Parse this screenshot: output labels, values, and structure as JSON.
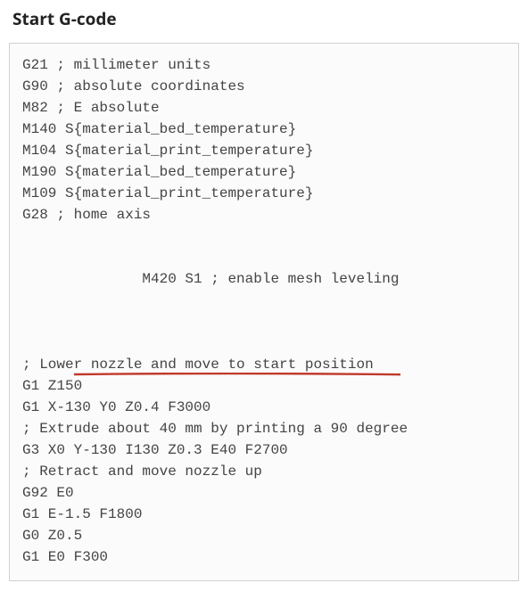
{
  "heading": "Start G-code",
  "code": {
    "lines": [
      "G21 ; millimeter units",
      "G90 ; absolute coordinates",
      "M82 ; E absolute",
      "M140 S{material_bed_temperature}",
      "M104 S{material_print_temperature}",
      "M190 S{material_bed_temperature}",
      "M109 S{material_print_temperature}",
      "G28 ; home axis",
      "M420 S1 ; enable mesh leveling",
      "; Lower nozzle and move to start position",
      "G1 Z150",
      "G1 X-130 Y0 Z0.4 F3000",
      "; Extrude about 40 mm by printing a 90 degree",
      "G3 X0 Y-130 I130 Z0.3 E40 F2700",
      "; Retract and move nozzle up",
      "G92 E0",
      "G1 E-1.5 F1800",
      "G0 Z0.5",
      "G1 E0 F300"
    ]
  },
  "annotation": {
    "highlighted_line_index": 8,
    "color": "#c0392b",
    "style": "underline"
  }
}
